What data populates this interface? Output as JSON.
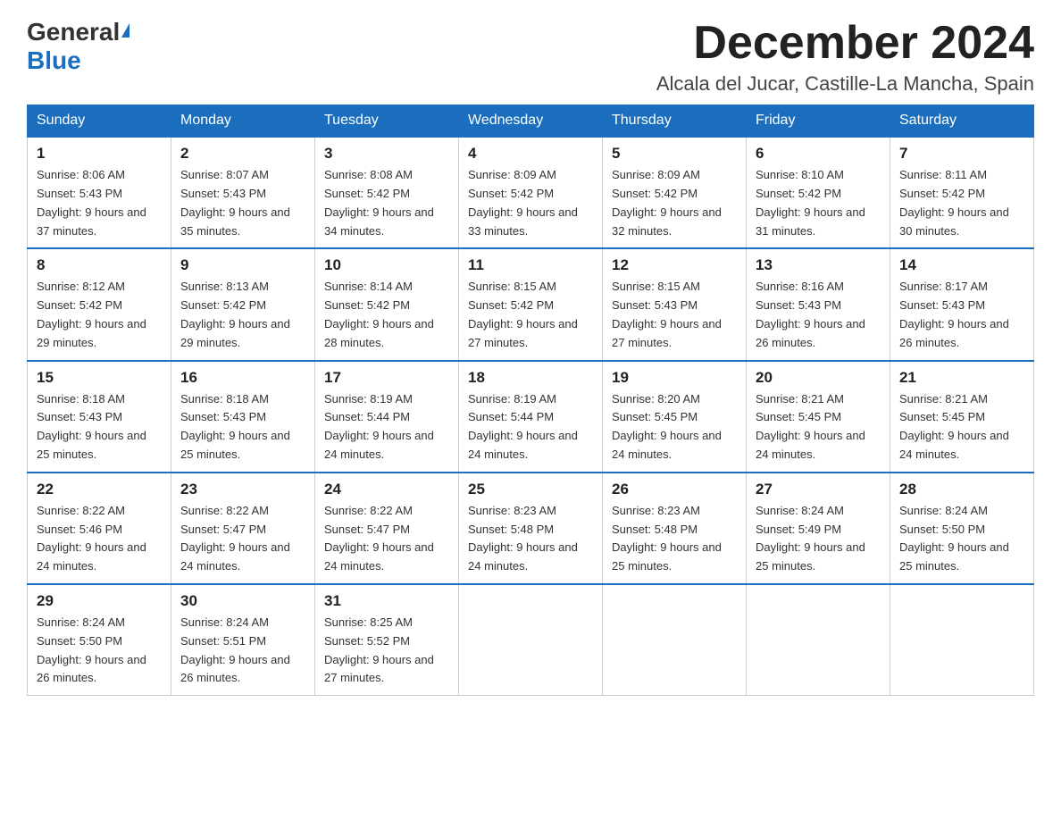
{
  "logo": {
    "line1": "General",
    "line2": "Blue"
  },
  "title": "December 2024",
  "location": "Alcala del Jucar, Castille-La Mancha, Spain",
  "days_of_week": [
    "Sunday",
    "Monday",
    "Tuesday",
    "Wednesday",
    "Thursday",
    "Friday",
    "Saturday"
  ],
  "weeks": [
    [
      {
        "day": "1",
        "sunrise": "8:06 AM",
        "sunset": "5:43 PM",
        "daylight": "9 hours and 37 minutes."
      },
      {
        "day": "2",
        "sunrise": "8:07 AM",
        "sunset": "5:43 PM",
        "daylight": "9 hours and 35 minutes."
      },
      {
        "day": "3",
        "sunrise": "8:08 AM",
        "sunset": "5:42 PM",
        "daylight": "9 hours and 34 minutes."
      },
      {
        "day": "4",
        "sunrise": "8:09 AM",
        "sunset": "5:42 PM",
        "daylight": "9 hours and 33 minutes."
      },
      {
        "day": "5",
        "sunrise": "8:09 AM",
        "sunset": "5:42 PM",
        "daylight": "9 hours and 32 minutes."
      },
      {
        "day": "6",
        "sunrise": "8:10 AM",
        "sunset": "5:42 PM",
        "daylight": "9 hours and 31 minutes."
      },
      {
        "day": "7",
        "sunrise": "8:11 AM",
        "sunset": "5:42 PM",
        "daylight": "9 hours and 30 minutes."
      }
    ],
    [
      {
        "day": "8",
        "sunrise": "8:12 AM",
        "sunset": "5:42 PM",
        "daylight": "9 hours and 29 minutes."
      },
      {
        "day": "9",
        "sunrise": "8:13 AM",
        "sunset": "5:42 PM",
        "daylight": "9 hours and 29 minutes."
      },
      {
        "day": "10",
        "sunrise": "8:14 AM",
        "sunset": "5:42 PM",
        "daylight": "9 hours and 28 minutes."
      },
      {
        "day": "11",
        "sunrise": "8:15 AM",
        "sunset": "5:42 PM",
        "daylight": "9 hours and 27 minutes."
      },
      {
        "day": "12",
        "sunrise": "8:15 AM",
        "sunset": "5:43 PM",
        "daylight": "9 hours and 27 minutes."
      },
      {
        "day": "13",
        "sunrise": "8:16 AM",
        "sunset": "5:43 PM",
        "daylight": "9 hours and 26 minutes."
      },
      {
        "day": "14",
        "sunrise": "8:17 AM",
        "sunset": "5:43 PM",
        "daylight": "9 hours and 26 minutes."
      }
    ],
    [
      {
        "day": "15",
        "sunrise": "8:18 AM",
        "sunset": "5:43 PM",
        "daylight": "9 hours and 25 minutes."
      },
      {
        "day": "16",
        "sunrise": "8:18 AM",
        "sunset": "5:43 PM",
        "daylight": "9 hours and 25 minutes."
      },
      {
        "day": "17",
        "sunrise": "8:19 AM",
        "sunset": "5:44 PM",
        "daylight": "9 hours and 24 minutes."
      },
      {
        "day": "18",
        "sunrise": "8:19 AM",
        "sunset": "5:44 PM",
        "daylight": "9 hours and 24 minutes."
      },
      {
        "day": "19",
        "sunrise": "8:20 AM",
        "sunset": "5:45 PM",
        "daylight": "9 hours and 24 minutes."
      },
      {
        "day": "20",
        "sunrise": "8:21 AM",
        "sunset": "5:45 PM",
        "daylight": "9 hours and 24 minutes."
      },
      {
        "day": "21",
        "sunrise": "8:21 AM",
        "sunset": "5:45 PM",
        "daylight": "9 hours and 24 minutes."
      }
    ],
    [
      {
        "day": "22",
        "sunrise": "8:22 AM",
        "sunset": "5:46 PM",
        "daylight": "9 hours and 24 minutes."
      },
      {
        "day": "23",
        "sunrise": "8:22 AM",
        "sunset": "5:47 PM",
        "daylight": "9 hours and 24 minutes."
      },
      {
        "day": "24",
        "sunrise": "8:22 AM",
        "sunset": "5:47 PM",
        "daylight": "9 hours and 24 minutes."
      },
      {
        "day": "25",
        "sunrise": "8:23 AM",
        "sunset": "5:48 PM",
        "daylight": "9 hours and 24 minutes."
      },
      {
        "day": "26",
        "sunrise": "8:23 AM",
        "sunset": "5:48 PM",
        "daylight": "9 hours and 25 minutes."
      },
      {
        "day": "27",
        "sunrise": "8:24 AM",
        "sunset": "5:49 PM",
        "daylight": "9 hours and 25 minutes."
      },
      {
        "day": "28",
        "sunrise": "8:24 AM",
        "sunset": "5:50 PM",
        "daylight": "9 hours and 25 minutes."
      }
    ],
    [
      {
        "day": "29",
        "sunrise": "8:24 AM",
        "sunset": "5:50 PM",
        "daylight": "9 hours and 26 minutes."
      },
      {
        "day": "30",
        "sunrise": "8:24 AM",
        "sunset": "5:51 PM",
        "daylight": "9 hours and 26 minutes."
      },
      {
        "day": "31",
        "sunrise": "8:25 AM",
        "sunset": "5:52 PM",
        "daylight": "9 hours and 27 minutes."
      },
      null,
      null,
      null,
      null
    ]
  ]
}
